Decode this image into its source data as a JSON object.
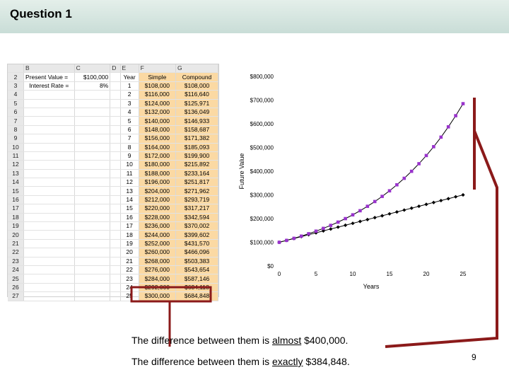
{
  "title": "Question 1",
  "spreadsheet": {
    "col_headers": [
      "",
      "B",
      "C",
      "D",
      "E",
      "F",
      "G"
    ],
    "rows_num": [
      "2",
      "3",
      "4",
      "5",
      "6",
      "7",
      "8",
      "9",
      "10",
      "11",
      "12",
      "13",
      "14",
      "15",
      "16",
      "17",
      "18",
      "19",
      "20",
      "21",
      "22",
      "23",
      "24",
      "25",
      "26",
      "27"
    ],
    "pv_label": "Present Value =",
    "pv_value": "$100,000",
    "rate_label": "Interest Rate =",
    "rate_value": "8%",
    "table_headers": [
      "Year",
      "Simple",
      "Compound"
    ],
    "years": [
      "1",
      "2",
      "3",
      "4",
      "5",
      "6",
      "7",
      "8",
      "9",
      "10",
      "11",
      "12",
      "13",
      "14",
      "15",
      "16",
      "17",
      "18",
      "19",
      "20",
      "21",
      "22",
      "23",
      "24",
      "25"
    ],
    "simple": [
      "$108,000",
      "$116,000",
      "$124,000",
      "$132,000",
      "$140,000",
      "$148,000",
      "$156,000",
      "$164,000",
      "$172,000",
      "$180,000",
      "$188,000",
      "$196,000",
      "$204,000",
      "$212,000",
      "$220,000",
      "$228,000",
      "$236,000",
      "$244,000",
      "$252,000",
      "$260,000",
      "$268,000",
      "$276,000",
      "$284,000",
      "$292,000",
      "$300,000"
    ],
    "compound": [
      "$108,000",
      "$116,640",
      "$125,971",
      "$136,049",
      "$146,933",
      "$158,687",
      "$171,382",
      "$185,093",
      "$199,900",
      "$215,892",
      "$233,164",
      "$251,817",
      "$271,962",
      "$293,719",
      "$317,217",
      "$342,594",
      "$370,002",
      "$399,602",
      "$431,570",
      "$466,096",
      "$503,383",
      "$543,654",
      "$587,146",
      "$634,118",
      "$684,848"
    ]
  },
  "chart_data": {
    "type": "line",
    "xlabel": "Years",
    "ylabel": "Future Value",
    "xlim": [
      0,
      25
    ],
    "ylim": [
      0,
      800000
    ],
    "x_ticks": [
      "0",
      "5",
      "10",
      "15",
      "20",
      "25"
    ],
    "y_ticks": [
      "$0",
      "$100,000",
      "$200,000",
      "$300,000",
      "$400,000",
      "$500,000",
      "$600,000",
      "$700,000",
      "$800,000"
    ],
    "x": [
      0,
      1,
      2,
      3,
      4,
      5,
      6,
      7,
      8,
      9,
      10,
      11,
      12,
      13,
      14,
      15,
      16,
      17,
      18,
      19,
      20,
      21,
      22,
      23,
      24,
      25
    ],
    "series": [
      {
        "values": [
          100000,
          108000,
          116000,
          124000,
          132000,
          140000,
          148000,
          156000,
          164000,
          172000,
          180000,
          188000,
          196000,
          204000,
          212000,
          220000,
          228000,
          236000,
          244000,
          252000,
          260000,
          268000,
          276000,
          284000,
          292000,
          300000
        ],
        "color": "#000000",
        "marker": "diamond"
      },
      {
        "values": [
          100000,
          108000,
          116640,
          125971,
          136049,
          146933,
          158687,
          171382,
          185093,
          199900,
          215892,
          233164,
          251817,
          271962,
          293719,
          317217,
          342594,
          370002,
          399602,
          431570,
          466096,
          503383,
          543654,
          587146,
          634118,
          684848
        ],
        "color": "#9933cc",
        "marker": "square"
      }
    ]
  },
  "captions": {
    "line1_pre": "The difference between them is ",
    "line1_u": "almost",
    "line1_post": " $400,000.",
    "line2_pre": "The difference between them is ",
    "line2_u": "exactly",
    "line2_post": " $384,848."
  },
  "page_number": "9",
  "colors": {
    "bracket": "#8b1a1a",
    "highlight": "#fbd9a3",
    "simple_line": "#000000",
    "compound_line": "#9933cc"
  }
}
